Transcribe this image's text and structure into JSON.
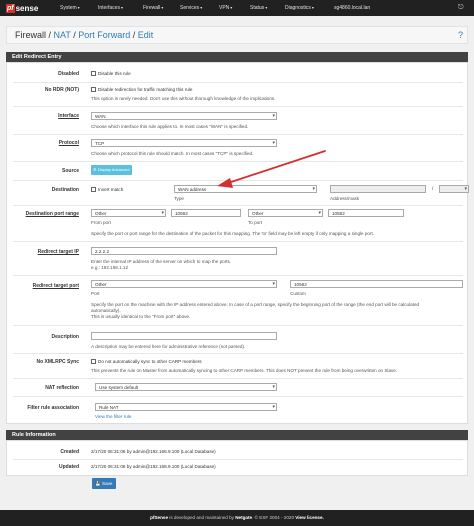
{
  "brand": {
    "pf": "pf",
    "sense": "sense"
  },
  "nav": {
    "items": [
      {
        "label": "System"
      },
      {
        "label": "Interfaces"
      },
      {
        "label": "Firewall"
      },
      {
        "label": "Services"
      },
      {
        "label": "VPN"
      },
      {
        "label": "Status"
      },
      {
        "label": "Diagnostics"
      },
      {
        "label": "sg4860.local.lan"
      }
    ],
    "logout_icon": "logout-icon"
  },
  "breadcrumb": {
    "part1": "Firewall",
    "sep": " / ",
    "part2": "NAT",
    "part3": "Port Forward",
    "part4": "Edit",
    "help_icon": "help-icon"
  },
  "panel": {
    "title": "Edit Redirect Entry"
  },
  "form": {
    "disabled": {
      "label": "Disabled",
      "checkbox_text": "Disable this rule"
    },
    "nordr": {
      "label": "No RDR (NOT)",
      "checkbox_text": "Disable redirection for traffic matching this rule",
      "help": "This option is rarely needed. Don't use this without thorough knowledge of the implications."
    },
    "interface": {
      "label": "Interface",
      "value": "WAN",
      "help": "Choose which interface this rule applies to. In most cases \"WAN\" is specified."
    },
    "protocol": {
      "label": "Protocol",
      "value": "TCP",
      "help": "Choose which protocol this rule should match. In most cases \"TCP\" is specified."
    },
    "source": {
      "label": "Source",
      "button": "Display Advanced"
    },
    "destination": {
      "label": "Destination",
      "invert": "Invert match.",
      "type_value": "WAN address",
      "type_label": "Type",
      "mask_label": "Address/mask",
      "mask_sep": "/"
    },
    "dest_port": {
      "label": "Destination port range",
      "from_type": "Other",
      "from_value": "10562",
      "from_label": "From port",
      "to_type": "Other",
      "to_value": "10562",
      "to_label": "To port",
      "help": "Specify the port or port range for the destination of the packet for this mapping. The 'to' field may be left empty if only mapping a single port."
    },
    "redirect_ip": {
      "label": "Redirect target IP",
      "value": "2.2.2.2",
      "help1": "Enter the internal IP address of the server on which to map the ports.",
      "help2": "e.g.: 192.168.1.12"
    },
    "redirect_port": {
      "label": "Redirect target port",
      "type": "Other",
      "type_label": "Port",
      "value": "10562",
      "value_label": "Custom",
      "help1": "Specify the port on the machine with the IP address entered above. In case of a port range, specify the beginning port of the range (the end port will be calculated",
      "help2": "automatically).",
      "help3": "This is usually identical to the \"From port\" above."
    },
    "description": {
      "label": "Description",
      "value": "",
      "help": "A description may be entered here for administrative reference (not parsed)."
    },
    "noxmlrpc": {
      "label": "No XMLRPC Sync",
      "checkbox_text": "Do not automatically sync to other CARP members",
      "help": "This prevents the rule on Master from automatically syncing to other CARP members. This does NOT prevent the rule from being overwritten on Slave."
    },
    "nat_reflection": {
      "label": "NAT reflection",
      "value": "Use system default"
    },
    "filter_rule": {
      "label": "Filter rule association",
      "value": "Rule NAT",
      "link": "View the filter rule"
    }
  },
  "rule_info": {
    "title": "Rule Information",
    "created_label": "Created",
    "created_value": "2/17/20 06:31:06 by admin@192.168.9.100 (Local Database)",
    "updated_label": "Updated",
    "updated_value": "2/17/20 06:31:06 by admin@192.168.9.100 (Local Database)"
  },
  "save_button": "Save",
  "footer": {
    "pfsense": "pfSense",
    "text1": " is developed and maintained by ",
    "netgate": "Netgate",
    "text2": ". © ESF 2004 - 2020 ",
    "license": "View license."
  },
  "colors": {
    "accent": "#337ab7",
    "brand_red": "#d6322a",
    "annotation_arrow": "#d32f2f",
    "navbar": "#212121"
  }
}
